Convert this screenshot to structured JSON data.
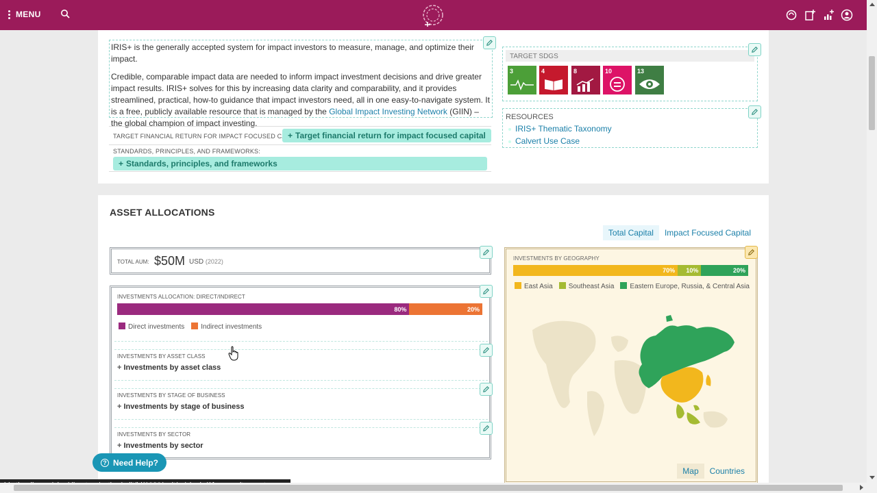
{
  "topbar": {
    "menu_label": "MENU",
    "icons": [
      "menu-dots-icon",
      "search-icon",
      "logo-icon",
      "sync-icon",
      "add-note-icon",
      "add-chart-icon",
      "user-icon"
    ]
  },
  "about": {
    "para1": "IRIS+ is the generally accepted system for impact investors to measure, manage, and optimize their impact.",
    "para2_before": "Credible, comparable impact data are needed to inform impact investment decisions and drive greater impact results. IRIS+ solves for this by increasing data clarity and comparability, and it provides streamlined, practical, how-to guidance that impact investors need, all in one easy-to-navigate system. It is a free, publicly available resource that is managed by the ",
    "para2_link": "Global Impact Investing Network",
    "para2_after": " (GIIN) – the global champion of impact investing."
  },
  "fields": {
    "target_label": "TARGET FINANCIAL RETURN FOR IMPACT FOCUSED CAPITAL:",
    "target_button": "Target financial return for impact focused capital",
    "standards_label": "STANDARDS, PRINCIPLES, AND FRAMEWORKS:",
    "standards_button": "Standards, principles, and frameworks"
  },
  "sdgs": {
    "header": "TARGET SDGS",
    "items": [
      {
        "num": "3",
        "label": "GOOD HEALTH AND WELL-BEING",
        "color": "#4c9f38",
        "icon": "heartbeat-icon"
      },
      {
        "num": "4",
        "label": "QUALITY EDUCATION",
        "color": "#c5192d",
        "icon": "book-icon"
      },
      {
        "num": "8",
        "label": "DECENT WORK AND ECONOMIC GROWTH",
        "color": "#a21942",
        "icon": "growth-chart-icon"
      },
      {
        "num": "10",
        "label": "REDUCED INEQUALITIES",
        "color": "#dd1367",
        "icon": "equality-icon"
      },
      {
        "num": "13",
        "label": "CLIMATE ACTION",
        "color": "#3f7e44",
        "icon": "eye-icon"
      }
    ]
  },
  "resources": {
    "title": "RESOURCES",
    "links": [
      "IRIS+ Thematic Taxonomy",
      "Calvert Use Case"
    ]
  },
  "asset_allocations": {
    "title": "ASSET ALLOCATIONS",
    "tabs": [
      "Total Capital",
      "Impact Focused Capital"
    ],
    "aum": {
      "label": "TOTAL AUM:",
      "value": "$50M",
      "currency": "USD",
      "year": "(2022)"
    },
    "direct_indirect": {
      "label": "INVESTMENTS ALLOCATION: DIRECT/INDIRECT",
      "segments": [
        {
          "name": "Direct investments",
          "value": 80,
          "label": "80%",
          "color": "#9a2a7e"
        },
        {
          "name": "Indirect investments",
          "value": 20,
          "label": "20%",
          "color": "#ec7434"
        }
      ]
    },
    "sections": [
      {
        "label": "INVESTMENTS BY ASSET CLASS",
        "title": "Investments by asset class"
      },
      {
        "label": "INVESTMENTS BY STAGE OF BUSINESS",
        "title": "Investments by stage of business"
      },
      {
        "label": "INVESTMENTS BY SECTOR",
        "title": "Investments by sector"
      }
    ],
    "geography": {
      "label": "INVESTMENTS BY GEOGRAPHY",
      "segments": [
        {
          "name": "East Asia",
          "value": 70,
          "label": "70%",
          "color": "#f2b71d"
        },
        {
          "name": "Southeast Asia",
          "value": 10,
          "label": "10%",
          "color": "#a5bb32"
        },
        {
          "name": "Eastern Europe, Russia, & Central Asia",
          "value": 20,
          "label": "20%",
          "color": "#2fa35a"
        }
      ],
      "tabs": [
        "Map",
        "Countries"
      ]
    }
  },
  "help_button": "Need Help?",
  "status_url": "iris.thegiin.org/plus/directory/action/edit/id/6020/unit/.../single/?form=unit_asset..."
}
